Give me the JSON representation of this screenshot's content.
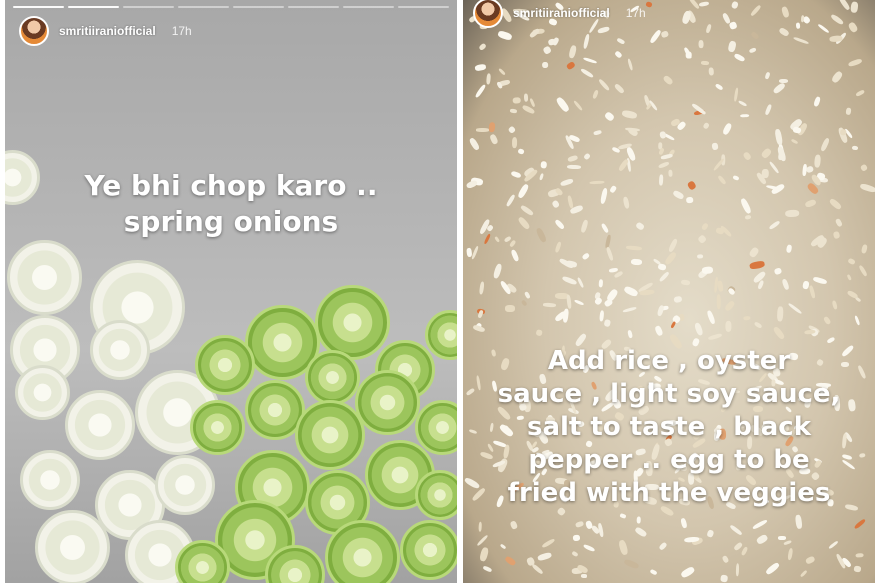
{
  "stories": [
    {
      "username": "smritiiraniofficial",
      "time": "17h",
      "caption": "Ye bhi chop karo ..\nspring onions",
      "progress_total": 8,
      "progress_done": 2
    },
    {
      "username": "smritiiraniofficial",
      "time": "17h",
      "caption": "Add rice , oyster\nsauce , light soy sauce,\nsalt to taste , black\npepper .. egg to be\nfried with the veggies"
    }
  ],
  "colors": {
    "progress_done": "#ffffff",
    "progress_remaining": "rgba(255,255,255,0.45)",
    "text": "#ffffff"
  }
}
